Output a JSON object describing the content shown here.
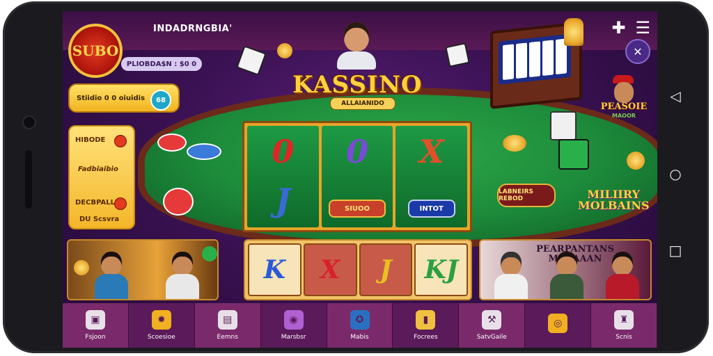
{
  "header": {
    "logo_text": "SUBO",
    "brand": "INDADRNGBIA'",
    "menu_icons": [
      "plus-icon",
      "hamburger-icon"
    ],
    "close_label": "✕"
  },
  "left_panel": {
    "stat_pill": "PLIOBDA$N : $0 0",
    "info_pill": "Stiidio 0 0 oiuidis",
    "info_badge": "68",
    "card_title": "HIBODE",
    "card_mid": "Fadbiaibio",
    "card_low": "DECBPALL",
    "card_footer": "DU Scsvra"
  },
  "center": {
    "title": "KASSINO",
    "subtitle": "ALLAIANIDO",
    "reels": [
      {
        "top": "0",
        "top_color": "#e02525",
        "bottom": "J",
        "bottom_color": "#3a6ad8"
      },
      {
        "top": "0",
        "top_color": "#7a4ad8",
        "bottom": "",
        "bottom_color": ""
      },
      {
        "top": "X",
        "top_color": "#e0502a",
        "bottom": "",
        "bottom_color": ""
      }
    ],
    "reel_button_1": "SIUOO",
    "reel_button_2": "INTOT"
  },
  "right_panel": {
    "dealer_label": "PEASOIE",
    "dealer_sub": "MAOOR",
    "sign": "LABNEIRS REBOD",
    "promo_line1": "MILIIRY",
    "promo_line2": "MOLBAINS"
  },
  "banners": {
    "middle_tiles": [
      {
        "glyph": "K",
        "color": "#2a5ad8"
      },
      {
        "glyph": "X",
        "color": "#d8202a"
      },
      {
        "glyph": "J",
        "color": "#e8c020"
      },
      {
        "glyph": "KJ",
        "color": "#2aa040"
      }
    ],
    "right_title": "PEARPANTANS MOLAAAN"
  },
  "bottom_nav": [
    {
      "label": "Fsjoon",
      "icon": "bag-icon",
      "color": "#e8e0e8"
    },
    {
      "label": "Scoesioe",
      "icon": "gear-icon",
      "color": "#f0b020"
    },
    {
      "label": "Eemns",
      "icon": "card-icon",
      "color": "#e8e0e8"
    },
    {
      "label": "Marsbsr",
      "icon": "globe-icon",
      "color": "#b060d0"
    },
    {
      "label": "Mabis",
      "icon": "badge-icon",
      "color": "#2a70c0"
    },
    {
      "label": "Focrees",
      "icon": "bucket-icon",
      "color": "#f0c040"
    },
    {
      "label": "SatvGaile",
      "icon": "hammer-icon",
      "color": "#e8e0e8"
    },
    {
      "label": "",
      "icon": "coin-icon",
      "color": "#f0b020"
    },
    {
      "label": "Scnis",
      "icon": "people-icon",
      "color": "#e8e0e8"
    }
  ]
}
